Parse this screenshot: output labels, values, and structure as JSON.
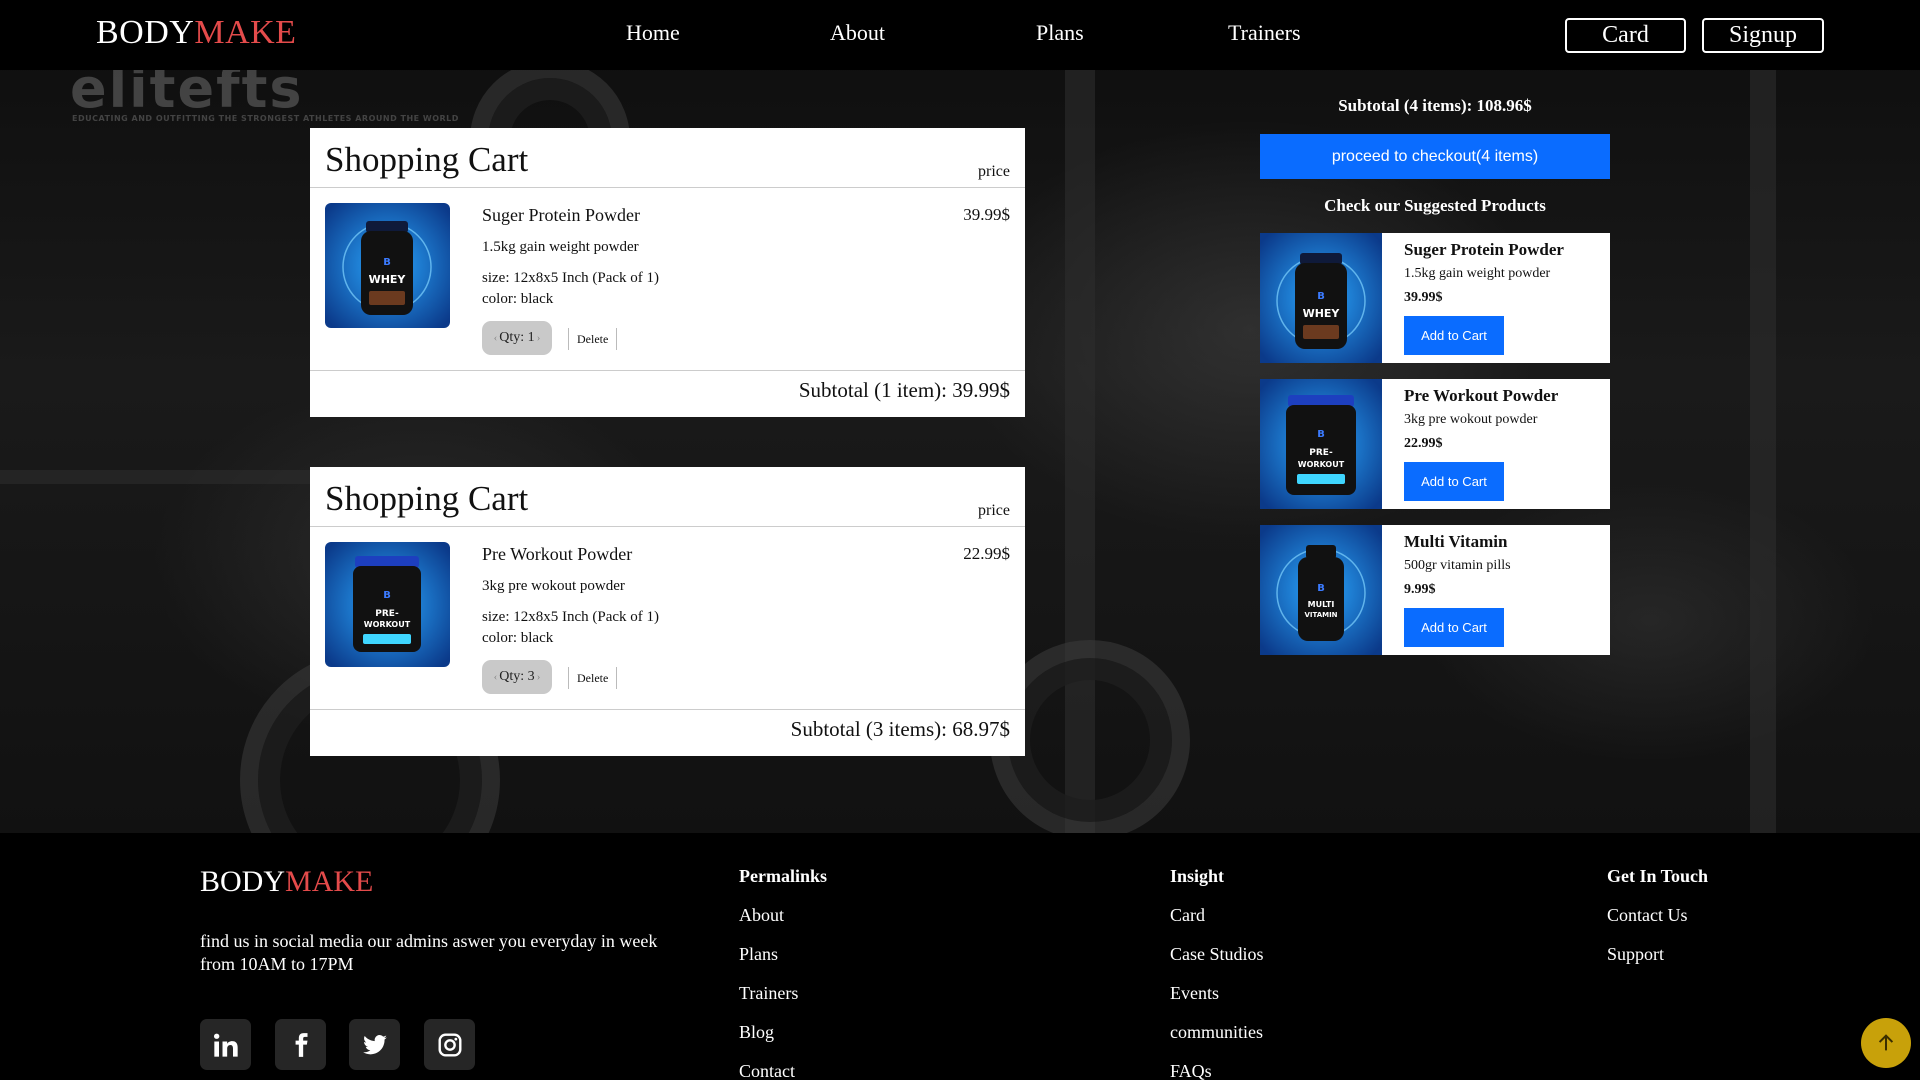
{
  "nav": {
    "logo_part1": "BODY",
    "logo_part2": "MAKE",
    "links": [
      "Home",
      "About",
      "Plans",
      "Trainers"
    ],
    "card_button": "Card",
    "signup_button": "Signup"
  },
  "watermark": {
    "brand": "elitefts",
    "tagline": "EDUCATING AND OUTFITTING THE STRONGEST ATHLETES AROUND THE WORLD"
  },
  "carts": [
    {
      "title": "Shopping Cart",
      "price_header": "price",
      "item": {
        "name": "Suger Protein Powder",
        "price": "39.99$",
        "description": "1.5kg gain weight powder",
        "size": "size: 12x8x5 Inch (Pack of 1)",
        "color": "color: black",
        "qty": "Qty: 1",
        "delete": "Delete"
      },
      "subtotal": "Subtotal (1 item): 39.99$"
    },
    {
      "title": "Shopping Cart",
      "price_header": "price",
      "item": {
        "name": "Pre Workout Powder",
        "price": "22.99$",
        "description": "3kg pre wokout powder",
        "size": "size: 12x8x5 Inch (Pack of 1)",
        "color": "color: black",
        "qty": "Qty: 3",
        "delete": "Delete"
      },
      "subtotal": "Subtotal (3 items): 68.97$"
    }
  ],
  "summary": {
    "subtotal": "Subtotal (4 items): 108.96$",
    "checkout_button": "proceed to checkout(4 items)",
    "suggested_title": "Check our Suggested Products"
  },
  "suggested": [
    {
      "name": "Suger Protein Powder",
      "description": "1.5kg gain weight powder",
      "price": "39.99$",
      "button": "Add to Cart"
    },
    {
      "name": "Pre Workout Powder",
      "description": "3kg pre wokout powder",
      "price": "22.99$",
      "button": "Add to Cart"
    },
    {
      "name": "Multi Vitamin",
      "description": "500gr vitamin pills",
      "price": "9.99$",
      "button": "Add to Cart"
    }
  ],
  "footer": {
    "logo_part1": "BODY",
    "logo_part2": "MAKE",
    "text": "find us in social media our admins aswer you everyday in week from 10AM to 17PM",
    "social_icons": [
      "linkedin-icon",
      "facebook-icon",
      "twitter-icon",
      "instagram-icon"
    ],
    "permalinks": {
      "title": "Permalinks",
      "links": [
        "About",
        "Plans",
        "Trainers",
        "Blog",
        "Contact"
      ]
    },
    "insight": {
      "title": "Insight",
      "links": [
        "Card",
        "Case Studios",
        "Events",
        "communities",
        "FAQs"
      ]
    },
    "contact": {
      "title": "Get In Touch",
      "links": [
        "Contact Us",
        "Support"
      ]
    }
  },
  "colors": {
    "brand_accent": "#e44b4b",
    "button_blue": "#0a6cff",
    "back_to_top": "#c8a10a"
  }
}
